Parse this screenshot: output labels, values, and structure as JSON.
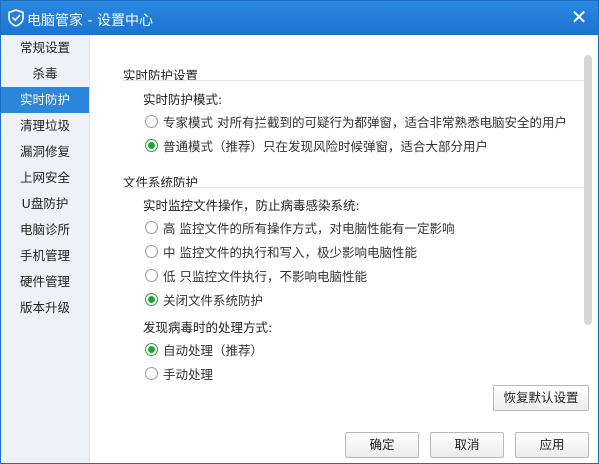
{
  "window": {
    "title": "电脑管家 - 设置中心",
    "close_label": "✕",
    "brand_color": "#1c74d1"
  },
  "sidebar": {
    "items": [
      {
        "label": "常规设置",
        "active": false
      },
      {
        "label": "杀毒",
        "active": false
      },
      {
        "label": "实时防护",
        "active": true
      },
      {
        "label": "清理垃圾",
        "active": false
      },
      {
        "label": "漏洞修复",
        "active": false
      },
      {
        "label": "上网安全",
        "active": false
      },
      {
        "label": "U盘防护",
        "active": false
      },
      {
        "label": "电脑诊所",
        "active": false
      },
      {
        "label": "手机管理",
        "active": false
      },
      {
        "label": "硬件管理",
        "active": false
      },
      {
        "label": "版本升级",
        "active": false
      }
    ]
  },
  "realtime": {
    "section_title": "实时防护设置",
    "mode_title": "实时防护模式:",
    "options": [
      {
        "label": "专家模式  对所有拦截到的可疑行为都弹窗，适合非常熟悉电脑安全的用户",
        "checked": false
      },
      {
        "label": "普通模式（推荐）只在发现风险时候弹窗，适合大部分用户",
        "checked": true
      }
    ]
  },
  "filesystem": {
    "section_title": "文件系统防护",
    "monitor_title": "实时监控文件操作，防止病毒感染系统:",
    "options": [
      {
        "label": "高   监控文件的所有操作方式，对电脑性能有一定影响",
        "checked": false
      },
      {
        "label": "中   监控文件的执行和写入，极少影响电脑性能",
        "checked": false
      },
      {
        "label": "低   只监控文件执行，不影响电脑性能",
        "checked": false
      },
      {
        "label": "关闭文件系统防护",
        "checked": true
      }
    ],
    "handle_title": "发现病毒时的处理方式:",
    "handle_options": [
      {
        "label": "自动处理（推荐）",
        "checked": true
      },
      {
        "label": "手动处理",
        "checked": false
      }
    ]
  },
  "buttons": {
    "restore_default": "恢复默认设置",
    "ok": "确定",
    "cancel": "取消",
    "apply": "应用"
  }
}
